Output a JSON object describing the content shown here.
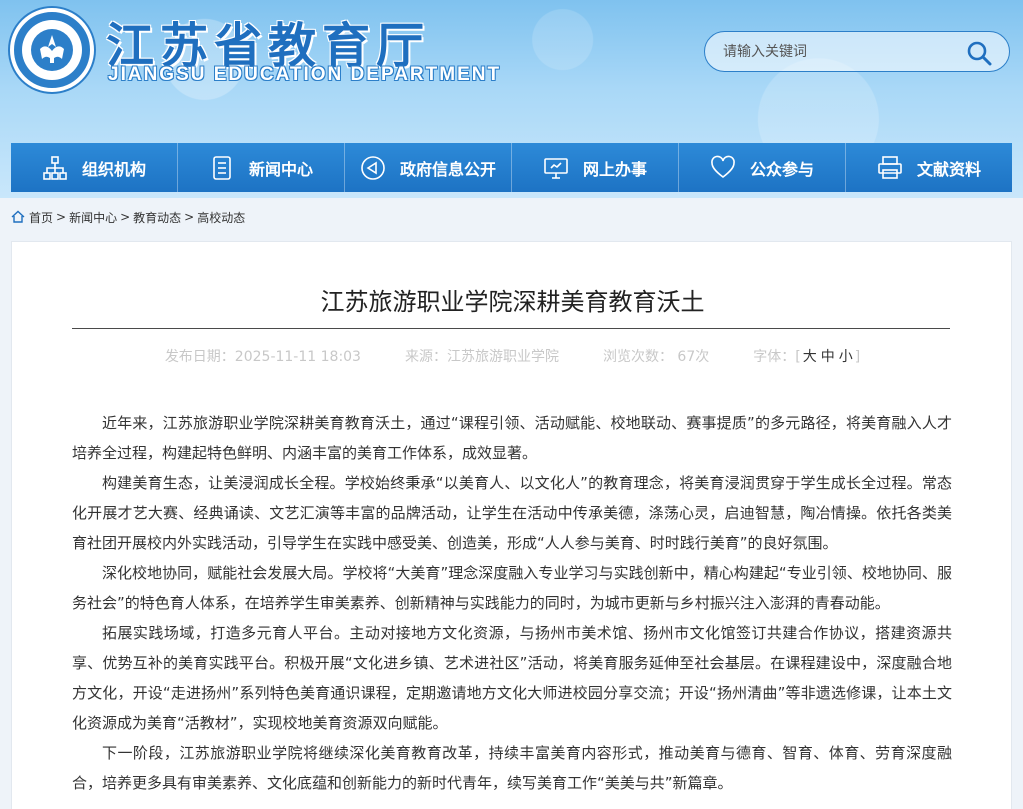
{
  "header": {
    "title": "江苏省教育厅",
    "subtitle": "JIANGSU EDUCATION DEPARTMENT",
    "search_placeholder": "请输入关键词"
  },
  "nav": {
    "items": [
      {
        "label": "组织机构",
        "icon": "org-chart-icon"
      },
      {
        "label": "新闻中心",
        "icon": "document-icon"
      },
      {
        "label": "政府信息公开",
        "icon": "megaphone-icon"
      },
      {
        "label": "网上办事",
        "icon": "monitor-icon"
      },
      {
        "label": "公众参与",
        "icon": "heart-icon"
      },
      {
        "label": "文献资料",
        "icon": "printer-icon"
      }
    ]
  },
  "breadcrumb": {
    "items": [
      "首页",
      "新闻中心",
      "教育动态",
      "高校动态"
    ],
    "separator": ">"
  },
  "article": {
    "title": "江苏旅游职业学院深耕美育教育沃土",
    "publish_date": "发布日期：2025-11-11 18:03",
    "source": "来源：江苏旅游职业学院",
    "views": "浏览次数：  67次",
    "font_size_label": "字体：[",
    "font_large": "大",
    "font_medium": "中",
    "font_small": "小",
    "font_size_close": "]",
    "paragraphs": [
      "近年来，江苏旅游职业学院深耕美育教育沃土，通过“课程引领、活动赋能、校地联动、赛事提质”的多元路径，将美育融入人才培养全过程，构建起特色鲜明、内涵丰富的美育工作体系，成效显著。",
      "构建美育生态，让美浸润成长全程。学校始终秉承“以美育人、以文化人”的教育理念，将美育浸润贯穿于学生成长全过程。常态化开展才艺大赛、经典诵读、文艺汇演等丰富的品牌活动，让学生在活动中传承美德，涤荡心灵，启迪智慧，陶冶情操。依托各类美育社团开展校内外实践活动，引导学生在实践中感受美、创造美，形成“人人参与美育、时时践行美育”的良好氛围。",
      "深化校地协同，赋能社会发展大局。学校将“大美育”理念深度融入专业学习与实践创新中，精心构建起“专业引领、校地协同、服务社会”的特色育人体系，在培养学生审美素养、创新精神与实践能力的同时，为城市更新与乡村振兴注入澎湃的青春动能。",
      "拓展实践场域，打造多元育人平台。主动对接地方文化资源，与扬州市美术馆、扬州市文化馆签订共建合作协议，搭建资源共享、优势互补的美育实践平台。积极开展“文化进乡镇、艺术进社区”活动，将美育服务延伸至社会基层。在课程建设中，深度融合地方文化，开设“走进扬州”系列特色美育通识课程，定期邀请地方文化大师进校园分享交流；开设“扬州清曲”等非遗选修课，让本土文化资源成为美育“活教材”，实现校地美育资源双向赋能。",
      "下一阶段，江苏旅游职业学院将继续深化美育教育改革，持续丰富美育内容形式，推动美育与德育、智育、体育、劳育深度融合，培养更多具有审美素养、文化底蕴和创新能力的新时代青年，续写美育工作“美美与共”新篇章。"
    ]
  },
  "colors": {
    "brand_blue": "#1f6fbf",
    "nav_blue": "#1d73c4",
    "header_sky": "#a9d8f7"
  }
}
